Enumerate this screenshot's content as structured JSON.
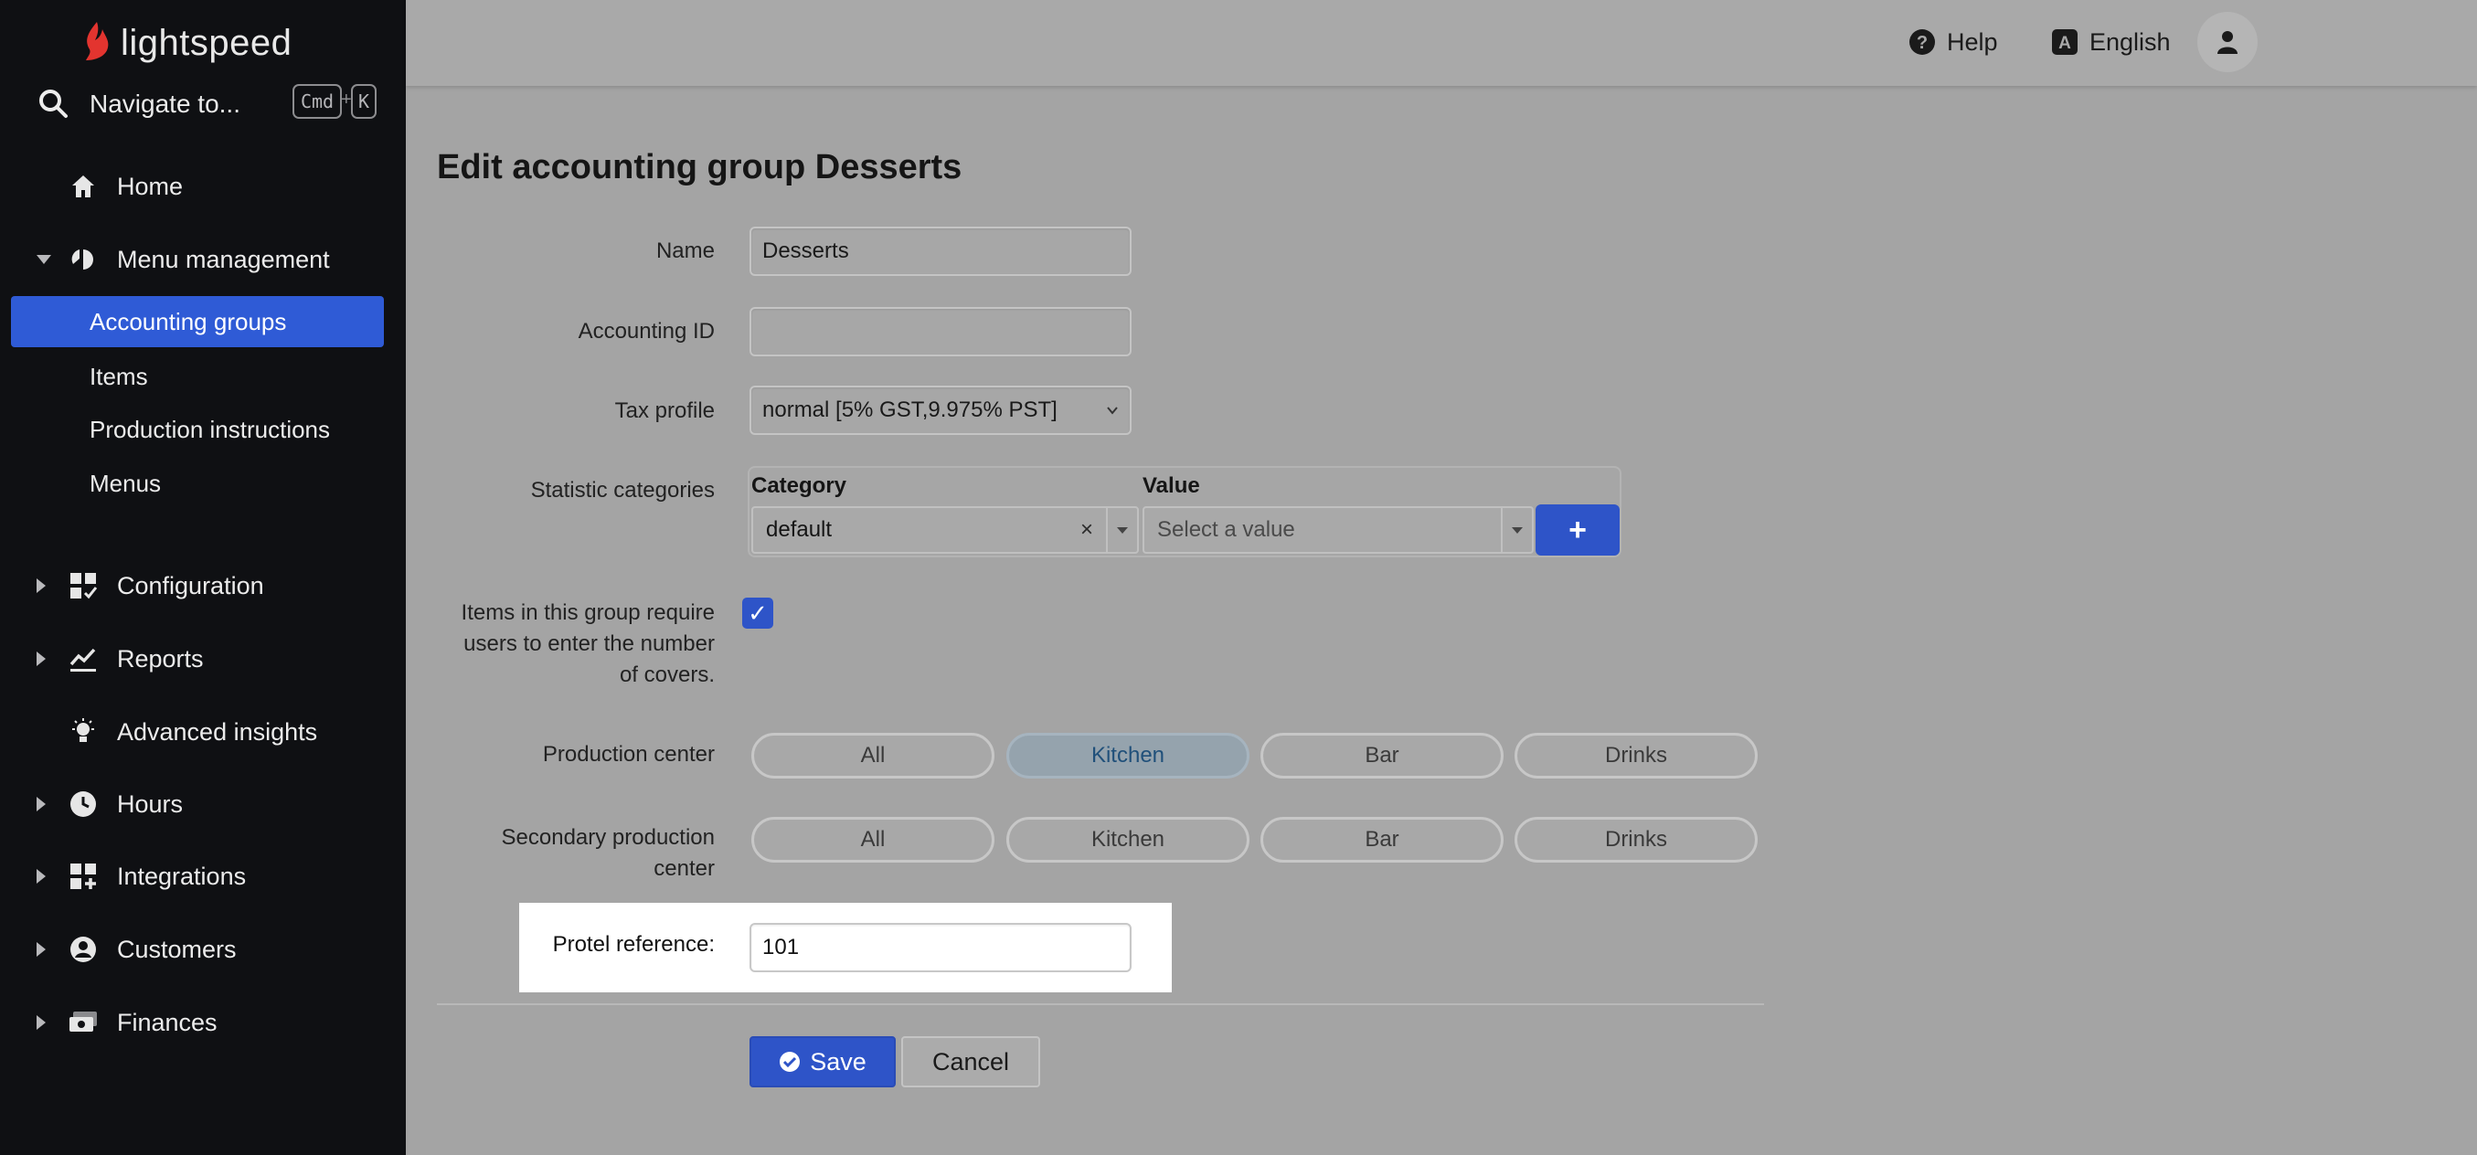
{
  "brand": {
    "logo_text": "lightspeed"
  },
  "navigate": {
    "label": "Navigate to...",
    "shortcut_cmd": "Cmd",
    "shortcut_plus": "+",
    "shortcut_key": "K"
  },
  "sidebar": {
    "items": [
      {
        "label": "Home",
        "icon": "home-icon"
      },
      {
        "label": "Menu management",
        "icon": "menu-management-icon",
        "expanded": true
      },
      {
        "label": "Configuration",
        "icon": "configuration-icon"
      },
      {
        "label": "Reports",
        "icon": "reports-icon"
      },
      {
        "label": "Advanced insights",
        "icon": "lightbulb-icon"
      },
      {
        "label": "Hours",
        "icon": "clock-icon"
      },
      {
        "label": "Integrations",
        "icon": "integrations-icon"
      },
      {
        "label": "Customers",
        "icon": "customers-icon"
      },
      {
        "label": "Finances",
        "icon": "finances-icon"
      }
    ],
    "sub_items": [
      {
        "label": "Accounting groups",
        "active": true
      },
      {
        "label": "Items"
      },
      {
        "label": "Production instructions"
      },
      {
        "label": "Menus"
      }
    ]
  },
  "topbar": {
    "help_label": "Help",
    "language_label": "English",
    "language_badge": "A"
  },
  "form": {
    "title": "Edit accounting group Desserts",
    "name_label": "Name",
    "name_value": "Desserts",
    "accounting_id_label": "Accounting ID",
    "accounting_id_value": "",
    "tax_profile_label": "Tax profile",
    "tax_profile_value": "normal [5% GST,9.975% PST]",
    "statistic_label": "Statistic categories",
    "category_header": "Category",
    "value_header": "Value",
    "category_value": "default",
    "value_placeholder": "Select a value",
    "clear_symbol": "×",
    "plus_symbol": "+",
    "covers_label_lines": [
      "Items in this group require",
      "users to enter the number",
      "of covers."
    ],
    "covers_checked": true,
    "check_symbol": "✓",
    "production_center_label": "Production center",
    "secondary_production_label_lines": [
      "Secondary production",
      "center"
    ],
    "production_options": [
      "All",
      "Kitchen",
      "Bar",
      "Drinks"
    ],
    "production_selected": "Kitchen",
    "secondary_options": [
      "All",
      "Kitchen",
      "Bar",
      "Drinks"
    ],
    "protel_label": "Protel reference:",
    "protel_value": "101",
    "save_label": "Save",
    "cancel_label": "Cancel"
  },
  "colors": {
    "accent": "#2e54c8",
    "sidebar_bg": "#0f1013",
    "active_nav": "#2f5bd6",
    "overlay": "#a4a4a4"
  }
}
